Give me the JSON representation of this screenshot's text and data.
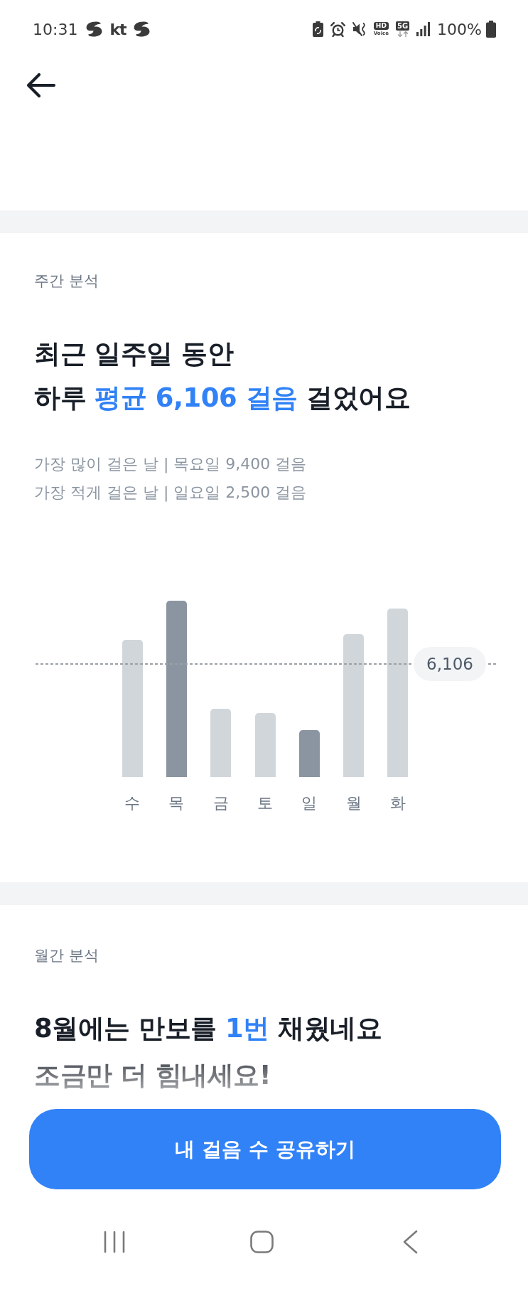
{
  "status_bar": {
    "time": "10:31",
    "carrier": "kt",
    "hd_badge": "HD",
    "hd_caption": "Voice",
    "network": "5G",
    "battery": "100%"
  },
  "weekly": {
    "section_label": "주간 분석",
    "headline": [
      [
        {
          "text": "최근 일주일 동안",
          "highlight": false
        }
      ],
      [
        {
          "text": "하루 ",
          "highlight": false
        },
        {
          "text": "평균 6,106 걸음",
          "highlight": true
        },
        {
          "text": " 걸었어요",
          "highlight": false
        }
      ]
    ],
    "details": [
      "가장 많이 걸은 날 | 목요일 9,400 걸음",
      "가장 적게 걸은 날 | 일요일 2,500 걸음"
    ],
    "chart": {
      "average_label": "6,106",
      "days": [
        {
          "label": "수",
          "highlighted": false
        },
        {
          "label": "목",
          "highlighted": true
        },
        {
          "label": "금",
          "highlighted": false
        },
        {
          "label": "토",
          "highlighted": false
        },
        {
          "label": "일",
          "highlighted": true
        },
        {
          "label": "월",
          "highlighted": false
        },
        {
          "label": "화",
          "highlighted": false
        }
      ]
    }
  },
  "monthly": {
    "section_label": "월간 분석",
    "headline": [
      [
        {
          "text": "8월에는 만보를 ",
          "highlight": false
        },
        {
          "text": "1번",
          "highlight": true
        },
        {
          "text": " 채웠네요",
          "highlight": false
        }
      ],
      [
        {
          "text": "조금만 더 힘내세요!",
          "highlight": false
        }
      ]
    ]
  },
  "share_button": {
    "label": "내 걸음 수 공유하기"
  }
}
